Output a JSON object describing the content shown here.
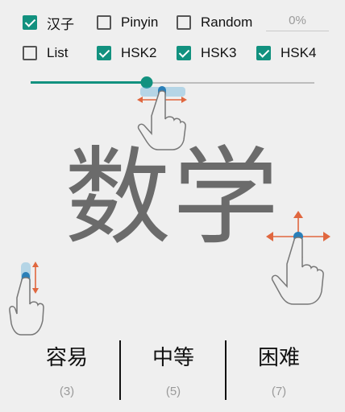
{
  "options": {
    "hanzi": {
      "label": "汉子",
      "checked": true
    },
    "pinyin": {
      "label": "Pinyin",
      "checked": false
    },
    "random": {
      "label": "Random",
      "checked": false
    },
    "list": {
      "label": "List",
      "checked": false
    },
    "hsk2": {
      "label": "HSK2",
      "checked": true
    },
    "hsk3": {
      "label": "HSK3",
      "checked": true
    },
    "hsk4": {
      "label": "HSK4",
      "checked": true
    }
  },
  "progress_text": "0%",
  "slider": {
    "value_fraction": 0.41
  },
  "word": "数学",
  "difficulty": [
    {
      "label": "容易",
      "count": "(3)"
    },
    {
      "label": "中等",
      "count": "(5)"
    },
    {
      "label": "困难",
      "count": "(7)"
    }
  ],
  "colors": {
    "accent": "#12917f",
    "arrow": "#e0673f",
    "finger_touch": "#4aa6d8"
  },
  "icons": [
    "swipe-horizontal-hand-icon",
    "swipe-vertical-hand-icon",
    "swipe-all-directions-hand-icon"
  ]
}
